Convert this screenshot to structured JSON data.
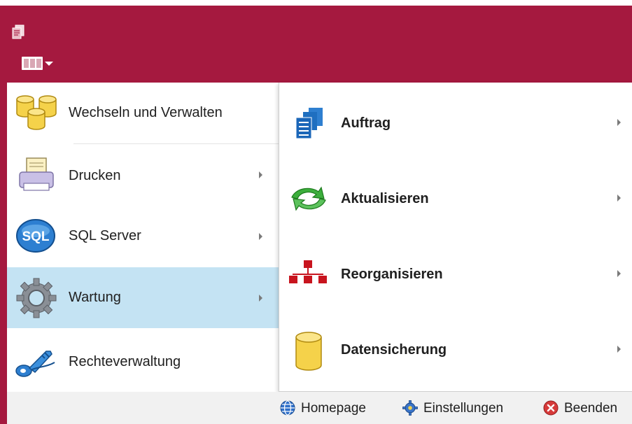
{
  "left_menu": {
    "items": [
      {
        "label": "Wechseln und Verwalten",
        "icon": "database-stack-icon",
        "has_submenu": false
      },
      {
        "label": "Drucken",
        "icon": "printer-icon",
        "has_submenu": true
      },
      {
        "label": "SQL Server",
        "icon": "sql-icon",
        "has_submenu": true
      },
      {
        "label": "Wartung",
        "icon": "gear-icon",
        "has_submenu": true,
        "selected": true
      },
      {
        "label": "Rechteverwaltung",
        "icon": "key-icon",
        "has_submenu": false
      }
    ]
  },
  "sql_icon_text": "SQL",
  "submenu": {
    "items": [
      {
        "label": "Auftrag",
        "icon": "documents-icon"
      },
      {
        "label": "Aktualisieren",
        "icon": "refresh-arrows-icon"
      },
      {
        "label": "Reorganisieren",
        "icon": "hierarchy-icon"
      },
      {
        "label": "Datensicherung",
        "icon": "database-icon"
      }
    ]
  },
  "footer": {
    "homepage_label": "Homepage",
    "settings_label": "Einstellungen",
    "exit_label": "Beenden"
  },
  "colors": {
    "titlebar": "#a5193f",
    "selected_item": "#c4e3f3",
    "footer": "#f1f1f1"
  }
}
